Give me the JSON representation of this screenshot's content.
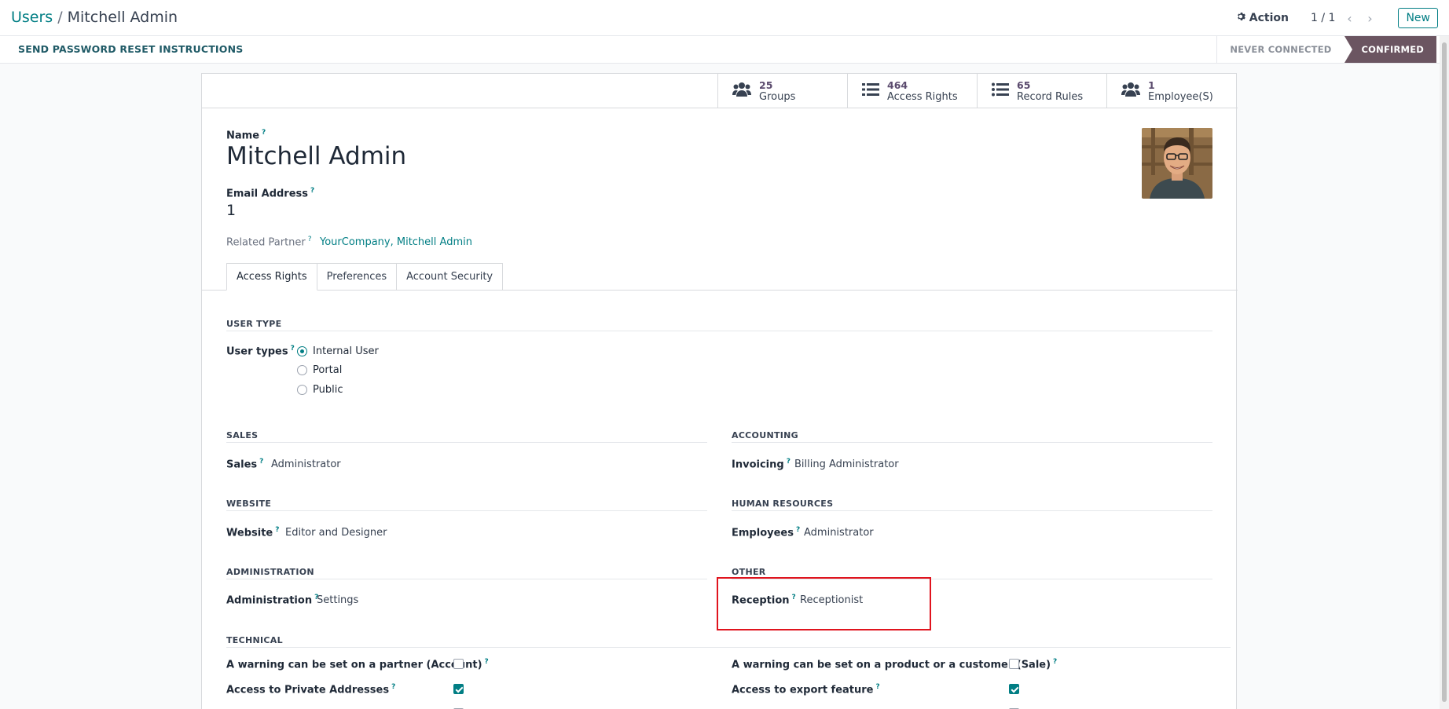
{
  "breadcrumb": {
    "parent": "Users",
    "separator": "/",
    "current": "Mitchell Admin"
  },
  "toolbar": {
    "action_label": "Action",
    "pager": "1 / 1",
    "new_label": "New"
  },
  "statusbar": {
    "reset_label": "SEND PASSWORD RESET INSTRUCTIONS",
    "stages": [
      "NEVER CONNECTED",
      "CONFIRMED"
    ],
    "active_stage": "CONFIRMED"
  },
  "stats": [
    {
      "value": "25",
      "label": "Groups",
      "icon": "users-icon"
    },
    {
      "value": "464",
      "label": "Access Rights",
      "icon": "list-icon"
    },
    {
      "value": "65",
      "label": "Record Rules",
      "icon": "list-icon"
    },
    {
      "value": "1",
      "label": "Employee(S)",
      "icon": "users-icon"
    }
  ],
  "form": {
    "name_label": "Name",
    "name_value": "Mitchell Admin",
    "email_label": "Email Address",
    "email_value": "1",
    "partner_label": "Related Partner",
    "partner_value": "YourCompany, Mitchell Admin",
    "help_mark": "?"
  },
  "tabs": [
    "Access Rights",
    "Preferences",
    "Account Security"
  ],
  "user_type": {
    "title": "USER TYPE",
    "label": "User types",
    "options": [
      "Internal User",
      "Portal",
      "Public"
    ],
    "selected": "Internal User"
  },
  "sections": {
    "sales": {
      "title": "SALES",
      "label": "Sales",
      "value": "Administrator"
    },
    "accounting": {
      "title": "ACCOUNTING",
      "label": "Invoicing",
      "value": "Billing Administrator"
    },
    "website": {
      "title": "WEBSITE",
      "label": "Website",
      "value": "Editor and Designer"
    },
    "hr": {
      "title": "HUMAN RESOURCES",
      "label": "Employees",
      "value": "Administrator"
    },
    "administration": {
      "title": "ADMINISTRATION",
      "label": "Administration",
      "value": "Settings"
    },
    "other": {
      "title": "OTHER",
      "label": "Reception",
      "value": "Receptionist"
    }
  },
  "technical": {
    "title": "TECHNICAL",
    "items": [
      {
        "label": "A warning can be set on a partner (Account)",
        "checked": false
      },
      {
        "label": "A warning can be set on a product or a customer (Sale)",
        "checked": false
      },
      {
        "label": "Access to Private Addresses",
        "checked": true
      },
      {
        "label": "Access to export feature",
        "checked": true
      }
    ]
  },
  "colors": {
    "accent": "#017e84",
    "stage_active": "#6b5561",
    "highlight": "#e0141e"
  }
}
